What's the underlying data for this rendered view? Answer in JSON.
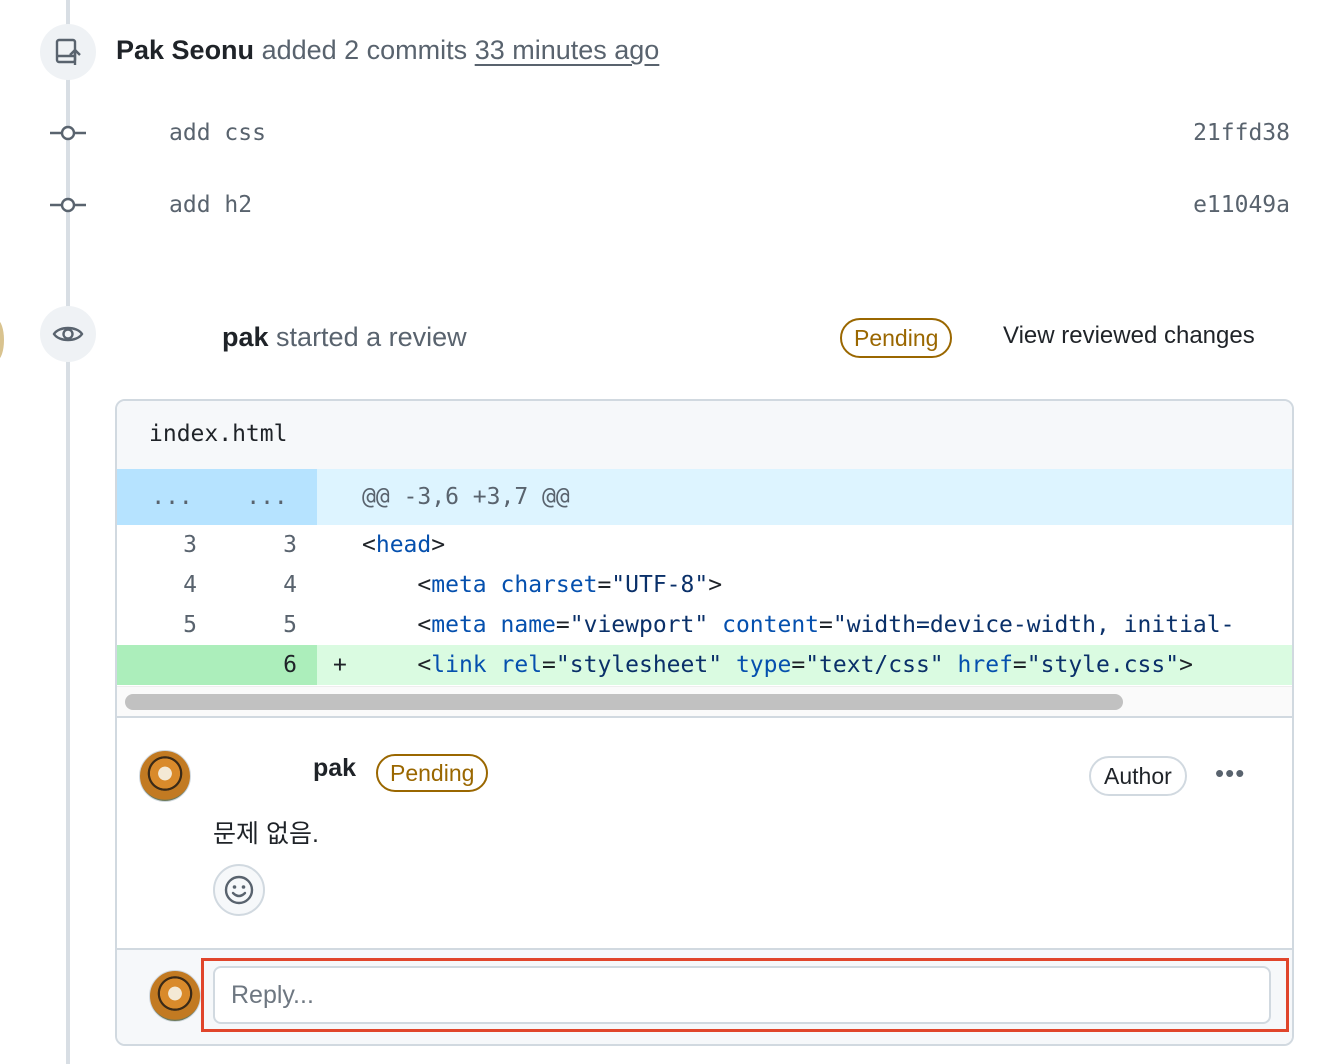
{
  "commits_event": {
    "actor": "Pak Seonu",
    "action": "added 2 commits",
    "time": "33 minutes ago",
    "commits": [
      {
        "message": "add css",
        "sha": "21ffd38"
      },
      {
        "message": "add h2",
        "sha": "e11049a"
      }
    ]
  },
  "review_event": {
    "actor": "pak",
    "action": "started a review",
    "status": "Pending",
    "view_changes_label": "View reviewed changes"
  },
  "diff": {
    "file_name": "index.html",
    "hunk": {
      "ln_old": "...",
      "ln_new": "...",
      "header": "@@ -3,6 +3,7 @@"
    },
    "lines": [
      {
        "old": "3",
        "new": "3",
        "sign": "",
        "type": "context"
      },
      {
        "old": "4",
        "new": "4",
        "sign": "",
        "type": "context"
      },
      {
        "old": "5",
        "new": "5",
        "sign": "",
        "type": "context"
      },
      {
        "old": "",
        "new": "6",
        "sign": "+",
        "type": "added"
      }
    ],
    "code_tokens": {
      "l1_tag": "head",
      "l2_tag": "meta",
      "l2_attr": "charset",
      "l2_val": "\"UTF-8\"",
      "l3_tag": "meta",
      "l3_attr1": "name",
      "l3_val1": "\"viewport\"",
      "l3_attr2": "content",
      "l3_val2": "\"width=device-width, initial-",
      "l4_tag": "link",
      "l4_attr1": "rel",
      "l4_val1": "\"stylesheet\"",
      "l4_attr2": "type",
      "l4_val2": "\"text/css\"",
      "l4_attr3": "href",
      "l4_val3": "\"style.css\""
    }
  },
  "comment": {
    "author": "pak",
    "status": "Pending",
    "role_badge": "Author",
    "more_label": "•••",
    "body": "문제 없음."
  },
  "reply": {
    "placeholder": "Reply..."
  },
  "colors": {
    "pending": "#9a6700",
    "highlight": "#e0452b",
    "hunk_bg": "#ddf4ff",
    "added_bg": "#dafbe1"
  }
}
